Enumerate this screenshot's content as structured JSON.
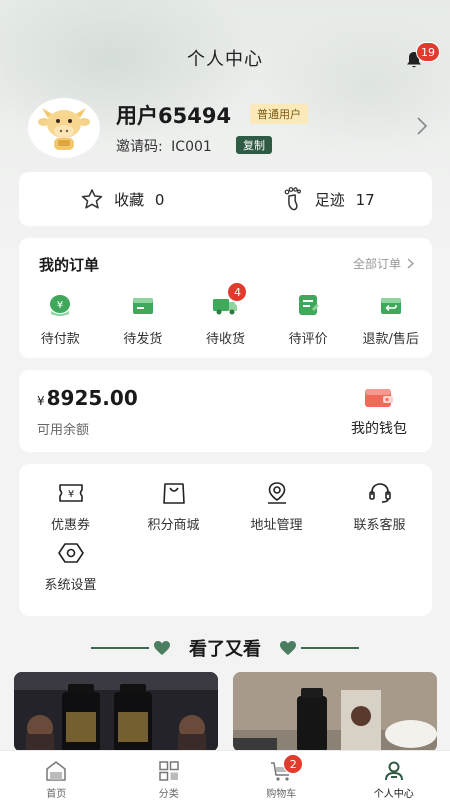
{
  "header": {
    "title": "个人中心",
    "notification_count": "19"
  },
  "profile": {
    "name": "用户65494",
    "tag": "普通用户",
    "invite_label": "邀请码:",
    "invite_code": "IC001",
    "copy_label": "复制"
  },
  "stats": {
    "favorites_label": "收藏",
    "favorites_count": "0",
    "footprints_label": "足迹",
    "footprints_count": "17"
  },
  "orders": {
    "title": "我的订单",
    "all_label": "全部订单",
    "items": [
      {
        "label": "待付款",
        "icon": "payment-icon"
      },
      {
        "label": "待发货",
        "icon": "to-ship-icon"
      },
      {
        "label": "待收货",
        "icon": "delivery-truck-icon",
        "badge": "4"
      },
      {
        "label": "待评价",
        "icon": "review-icon"
      },
      {
        "label": "退款/售后",
        "icon": "refund-icon"
      }
    ]
  },
  "wallet": {
    "currency": "¥",
    "balance": "8925.00",
    "balance_label": "可用余额",
    "entry_label": "我的钱包"
  },
  "tools": {
    "items": [
      {
        "label": "优惠券",
        "icon": "coupon-icon"
      },
      {
        "label": "积分商城",
        "icon": "points-mall-icon"
      },
      {
        "label": "地址管理",
        "icon": "location-icon"
      },
      {
        "label": "联系客服",
        "icon": "headset-icon"
      },
      {
        "label": "系统设置",
        "icon": "settings-icon"
      }
    ]
  },
  "recommend": {
    "title": "看了又看"
  },
  "tabbar": {
    "items": [
      {
        "label": "首页",
        "icon": "home-icon"
      },
      {
        "label": "分类",
        "icon": "category-icon"
      },
      {
        "label": "购物车",
        "icon": "cart-icon",
        "badge": "2"
      },
      {
        "label": "个人中心",
        "icon": "profile-icon",
        "active": true
      }
    ]
  },
  "colors": {
    "accent": "#2f5a43",
    "badge": "#e23b2e",
    "icon_green": "#3fa85b",
    "wallet_red": "#f06a5a"
  }
}
